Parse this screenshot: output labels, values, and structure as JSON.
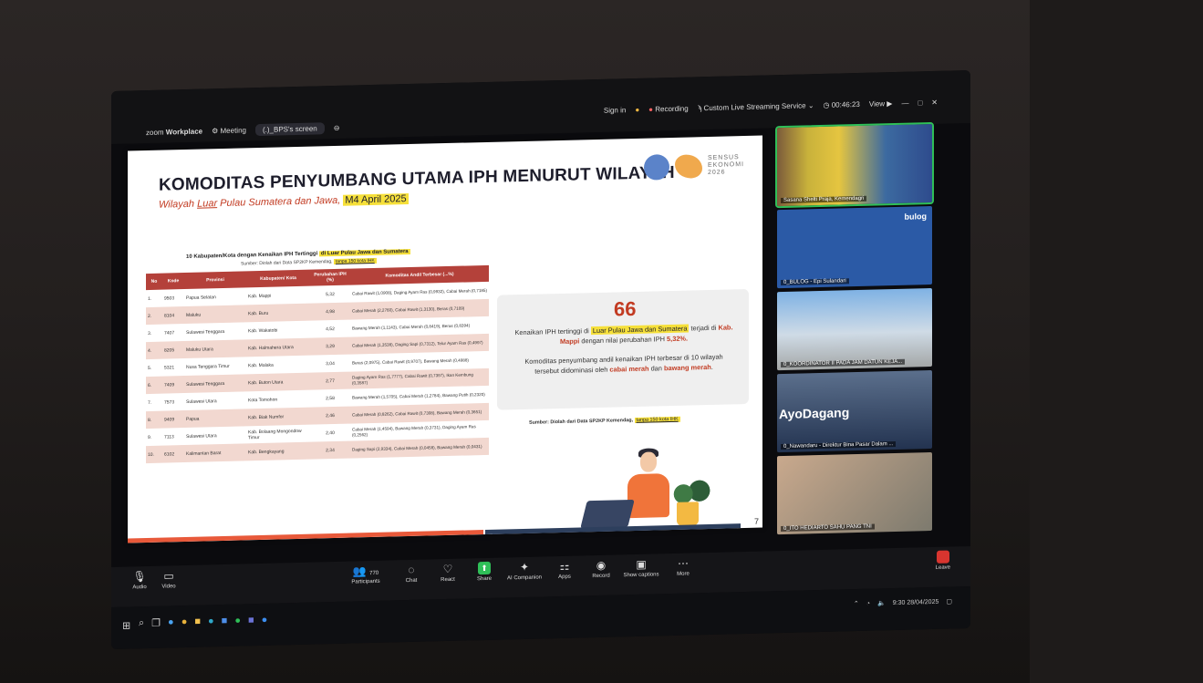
{
  "zoom": {
    "app_label": "zoom",
    "app_name": "Workplace",
    "meeting_menu": "Meeting",
    "share_pill": "(.)_BPS's screen",
    "sign_in": "Sign in",
    "recording": "Recording",
    "streaming": "Custom Live Streaming Service",
    "timer": "00:46:23",
    "view": "View"
  },
  "slide": {
    "title": "KOMODITAS PENYUMBANG UTAMA IPH MENURUT WILAYAH",
    "subtitle_prefix": "Wilayah ",
    "subtitle_underlined": "Luar",
    "subtitle_middle": " Pulau Sumatera dan Jawa, ",
    "subtitle_date": "M4 April 2025",
    "logo_text_1": "SENSUS",
    "logo_text_2": "EKONOMI",
    "logo_text_3": "2026",
    "table_title_prefix": "10 Kabupaten/Kota dengan Kenaikan IPH Tertinggi ",
    "table_title_hl": "di Luar Pulau Jawa dan Sumatera",
    "table_source_prefix": "Sumber: Diolah dari Data SP2KP Kemendag, ",
    "table_source_hl": "tanpa 150 kota IHK",
    "headers": [
      "No",
      "Kode",
      "Provinsi",
      "Kabupaten/ Kota",
      "Perubahan IPH (%)",
      "Komoditas Andil Terbesar (...%)"
    ],
    "rows": [
      {
        "no": "1.",
        "kode": "9503",
        "prov": "Papua Selatan",
        "kab": "Kab. Mappi",
        "iph": "5,32",
        "kom": "Cabai Rawit (1,0908), Daging Ayam Ras (0,9932), Cabai Merah (0,7185)"
      },
      {
        "no": "2.",
        "kode": "8104",
        "prov": "Maluku",
        "kab": "Kab. Buru",
        "iph": "4,98",
        "kom": "Cabai Merah (2,2760), Cabai Rawit (1,3130), Beras (0,7109)"
      },
      {
        "no": "3.",
        "kode": "7407",
        "prov": "Sulawesi Tenggara",
        "kab": "Kab. Wakatobi",
        "iph": "4,52",
        "kom": "Bawang Merah (1,1143), Cabai Merah (0,8419), Beras (0,8394)"
      },
      {
        "no": "4.",
        "kode": "8205",
        "prov": "Maluku Utara",
        "kab": "Kab. Halmahera Utara",
        "iph": "3,29",
        "kom": "Cabai Merah (1,3538), Daging Sapi (0,7312), Telur Ayam Ras (0,4997)"
      },
      {
        "no": "5.",
        "kode": "5321",
        "prov": "Nusa Tenggara Timur",
        "kab": "Kab. Malaka",
        "iph": "3,04",
        "kom": "Beras (2,0975), Cabai Rawit (0,9707), Bawang Merah (0,4988)"
      },
      {
        "no": "6.",
        "kode": "7409",
        "prov": "Sulawesi Tenggara",
        "kab": "Kab. Buton Utara",
        "iph": "2,77",
        "kom": "Daging Ayam Ras (1,7777), Cabai Rawit (0,7397), Ikan Kembung (0,3587)"
      },
      {
        "no": "7.",
        "kode": "7573",
        "prov": "Sulawesi Utara",
        "kab": "Kota Tomohon",
        "iph": "2,58",
        "kom": "Bawang Merah (1,5705), Cabai Merah (1,2784), Bawang Putih (0,2320)"
      },
      {
        "no": "8.",
        "kode": "9409",
        "prov": "Papua",
        "kab": "Kab. Biak Numfor",
        "iph": "2,46",
        "kom": "Cabai Merah (0,8262), Cabai Rawit (0,7308), Bawang Merah (0,3651)"
      },
      {
        "no": "9.",
        "kode": "7113",
        "prov": "Sulawesi Utara",
        "kab": "Kab. Bolaang Mongondow Timur",
        "iph": "2,40",
        "kom": "Cabai Merah (1,4594), Bawang Merah (0,3731), Daging Ayam Ras (0,2562)"
      },
      {
        "no": "10.",
        "kode": "6102",
        "prov": "Kalimantan Barat",
        "kab": "Kab. Bengkayang",
        "iph": "2,34",
        "kom": "Daging Sapi (2,9334), Cabai Merah (0,0458), Bawang Merah (0,0431)"
      }
    ],
    "quote_mark": "66",
    "quote_p1_a": "Kenaikan IPH tertinggi di ",
    "quote_p1_hl": "Luar Pulau Jawa dan Sumatera",
    "quote_p1_b": " terjadi di ",
    "quote_p1_kab": "Kab. Mappi",
    "quote_p1_c": " dengan nilai perubahan IPH ",
    "quote_p1_val": "5,32%.",
    "quote_p2_a": "Komoditas penyumbang andil kenaikan IPH terbesar di 10 wilayah tersebut didominasi oleh ",
    "quote_p2_red1": "cabai merah",
    "quote_p2_b": " dan ",
    "quote_p2_red2": "bawang merah",
    "quote_p2_c": ".",
    "quote_source_prefix": "Sumber: Diolah dari Data SP2KP Kemendag, ",
    "quote_source_hl": "tanpa 150 kota IHK",
    "page_number": "7"
  },
  "participants": [
    {
      "name": "Sasana Shelti Praja, Kemendagri"
    },
    {
      "name": "0_BULOG - Epi Sulandari"
    },
    {
      "name": "0_KOORDINATOR II PADA JAM DATUN KEJA..."
    },
    {
      "name": "0_Nawandaru - Direktur Bina Pasar Dalam ..."
    },
    {
      "name": "0_ITO HEDIARTO SAHU PANG TNI"
    }
  ],
  "tile_labels": {
    "bulog": "bulog",
    "ayo": "AyoDagang"
  },
  "controls": {
    "audio": "Audio",
    "video": "Video",
    "participants_count": "770",
    "participants": "Participants",
    "chat": "Chat",
    "react": "React",
    "share": "Share",
    "ai": "AI Companion",
    "apps": "Apps",
    "record": "Record",
    "captions": "Show captions",
    "more": "More",
    "leave": "Leave"
  },
  "taskbar": {
    "time": "9:30",
    "date": "28/04/2025"
  }
}
